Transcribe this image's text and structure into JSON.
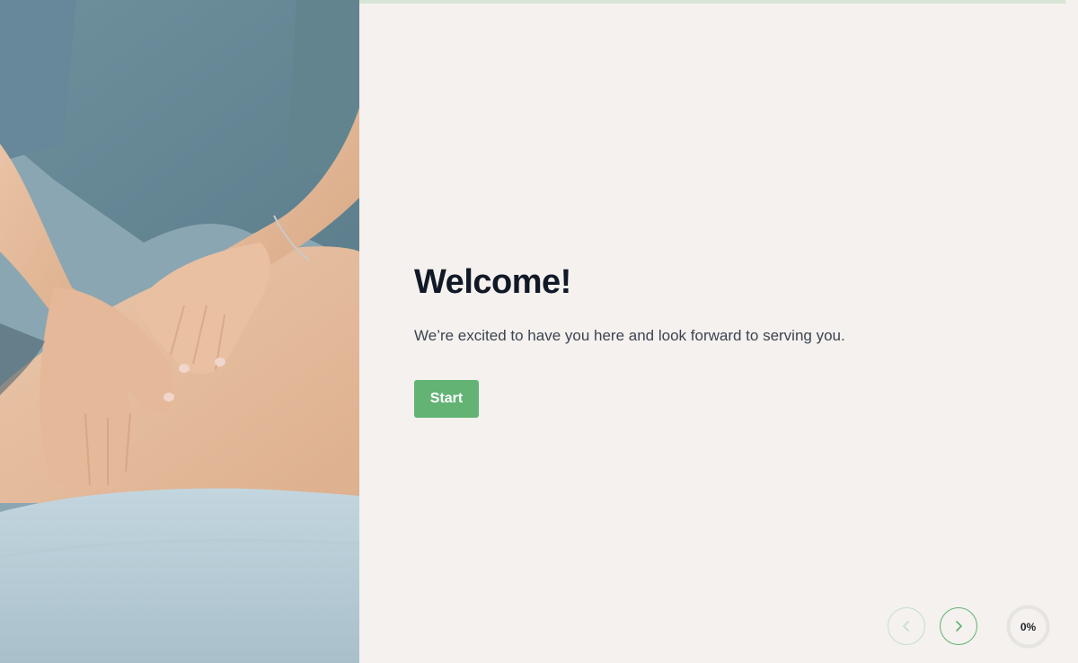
{
  "hero": {
    "image_icon": "massage-photo",
    "image_alt": ""
  },
  "welcome": {
    "title": "Welcome!",
    "subtitle": "We’re excited to have you here and look forward to serving you.",
    "start_label": "Start"
  },
  "navigation": {
    "prev_icon": "chevron-left-icon",
    "next_icon": "chevron-right-icon"
  },
  "progress": {
    "value": 0,
    "label": "0%"
  },
  "colors": {
    "background": "#f4f1ee",
    "accent": "#62b374",
    "accent_light": "#c5dfcb",
    "title": "#111827",
    "text": "#3d4451"
  }
}
